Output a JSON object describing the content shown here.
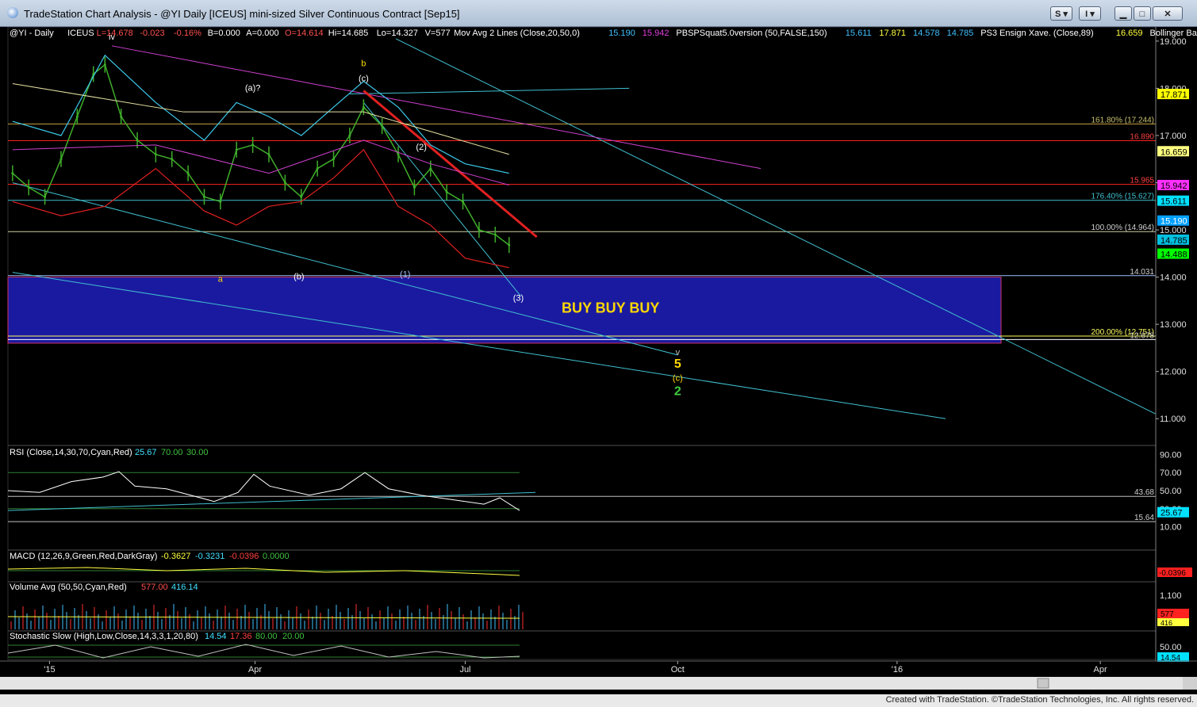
{
  "window": {
    "title": "TradeStation Chart Analysis - @YI Daily [ICEUS] mini-sized Silver Continuous Contract [Sep15]",
    "s_button": "S",
    "i_button": "I",
    "credit": "Created with TradeStation. ©TradeStation Technologies, Inc. All rights reserved."
  },
  "colors": {
    "background": "#000000",
    "price_bars": "#3fae2a",
    "bb_upper": "#3cc8ea",
    "bb_lower": "#e02020",
    "ma_magenta": "#d040d0",
    "ma_yellow": "#e6e0a0",
    "channel": "#40c0d0",
    "trend_red": "#e02020",
    "buy_zone": "#1a1aa0",
    "buy_text": "#ffd700"
  },
  "header": {
    "items": [
      {
        "text": "@YI - Daily",
        "color": "#ffffff"
      },
      {
        "text": "ICEUS",
        "color": "#ffffff"
      },
      {
        "text": "L=14.678",
        "color": "#ff5050"
      },
      {
        "text": "-0.023",
        "color": "#ff5050"
      },
      {
        "text": "-0.16%",
        "color": "#ff5050"
      },
      {
        "text": "B=0.000",
        "color": "#ffffff"
      },
      {
        "text": "A=0.000",
        "color": "#ffffff"
      },
      {
        "text": "O=14.614",
        "color": "#ff5050"
      },
      {
        "text": "Hi=14.685",
        "color": "#ffffff"
      },
      {
        "text": "Lo=14.327",
        "color": "#ffffff"
      },
      {
        "text": "V=577",
        "color": "#ffffff"
      },
      {
        "text": "Mov Avg 2 Lines (Close,20,50,0)",
        "color": "#ffffff"
      },
      {
        "text": "15.190",
        "color": "#40c0ff"
      },
      {
        "text": "15.942",
        "color": "#e040e0"
      },
      {
        "text": "PBSPSquat5.0version (50,FALSE,150)",
        "color": "#ffffff"
      },
      {
        "text": "15.611",
        "color": "#40c0ff"
      },
      {
        "text": "17.871",
        "color": "#ffff40"
      },
      {
        "text": "14.578",
        "color": "#40c0ff"
      },
      {
        "text": "14.785",
        "color": "#40c0ff"
      },
      {
        "text": "PS3 Ensign Xave. (Close,89)",
        "color": "#ffffff"
      },
      {
        "text": "16.659",
        "color": "#ffff40"
      },
      {
        "text": "Bollinger Bands (Close,Clos",
        "color": "#ffffff"
      }
    ]
  },
  "price_axis": {
    "ticks": [
      "19.000",
      "18.000",
      "17.000",
      "16.000",
      "15.000",
      "14.000",
      "13.000",
      "12.000",
      "11.000"
    ]
  },
  "price_badges": [
    {
      "value": 17.871,
      "text": "17.871",
      "bg": "#ffff00",
      "fg": "#000000"
    },
    {
      "value": 16.659,
      "text": "16.659",
      "bg": "#ffff80",
      "fg": "#000000"
    },
    {
      "value": 15.942,
      "text": "15.942",
      "bg": "#ff30ff",
      "fg": "#000000"
    },
    {
      "value": 15.611,
      "text": "15.611",
      "bg": "#00e0ff",
      "fg": "#000000"
    },
    {
      "value": 15.19,
      "text": "15.190",
      "bg": "#00a0ff",
      "fg": "#ffffff"
    },
    {
      "value": 14.785,
      "text": "14.785",
      "bg": "#00c0e0",
      "fg": "#000000"
    },
    {
      "value": 14.488,
      "text": "14.488",
      "bg": "#00ff00",
      "fg": "#000000"
    }
  ],
  "horizontal_lines": [
    {
      "value": 17.244,
      "label": "161.80% (17.244)",
      "color": "#c8a040",
      "label_color": "#c8c070"
    },
    {
      "value": 16.89,
      "label": "16.890",
      "color": "#ff2020",
      "label_color": "#ff4040"
    },
    {
      "value": 15.965,
      "label": "15.965",
      "color": "#ff2020",
      "label_color": "#ff4040"
    },
    {
      "value": 15.627,
      "label": "176.40% (15.627)",
      "color": "#40c0d0",
      "label_color": "#40c0d0"
    },
    {
      "value": 14.964,
      "label": "100.00% (14.964)",
      "color": "#d0d0a0",
      "label_color": "#d0d0d0"
    },
    {
      "value": 14.031,
      "label": "14.031",
      "color": "#a0c0ff",
      "label_color": "#d0d0d0"
    },
    {
      "value": 12.751,
      "label": "200.00% (12.751)",
      "color": "#ffff60",
      "label_color": "#ffff60"
    },
    {
      "value": 12.678,
      "label": "12.678",
      "color": "#ffffff",
      "label_color": "#d0d0d0"
    }
  ],
  "buy_zone": {
    "text": "BUY BUY BUY",
    "top": 14.0,
    "bottom": 12.6
  },
  "wave_labels": [
    {
      "text": "iv",
      "date": "2015-01-29",
      "value": 19.03,
      "color": "#ffffff"
    },
    {
      "text": "a",
      "date": "2015-03-17",
      "value": 13.9,
      "color": "#ffd700"
    },
    {
      "text": "(a)?",
      "date": "2015-03-31",
      "value": 17.95,
      "color": "#ffffff"
    },
    {
      "text": "(b)",
      "date": "2015-04-20",
      "value": 13.95,
      "color": "#ffffff"
    },
    {
      "text": "b",
      "date": "2015-05-18",
      "value": 18.47,
      "color": "#ffd700"
    },
    {
      "text": "(c)",
      "date": "2015-05-18",
      "value": 18.15,
      "color": "#ffffff"
    },
    {
      "text": "(1)",
      "date": "2015-06-05",
      "value": 14.0,
      "color": "#a0c0ff"
    },
    {
      "text": "(2)",
      "date": "2015-06-12",
      "value": 16.7,
      "color": "#ffffff"
    },
    {
      "text": "(3)",
      "date": "2015-07-24",
      "value": 13.5,
      "color": "#ffffff"
    },
    {
      "text": "v",
      "date": "2015-10-01",
      "value": 12.35,
      "color": "#c0c0c0"
    },
    {
      "text": "5",
      "date": "2015-10-01",
      "value": 12.08,
      "color": "#ffd700"
    },
    {
      "text": "(c)",
      "date": "2015-10-01",
      "value": 11.8,
      "color": "#ffd700"
    },
    {
      "text": "2",
      "date": "2015-10-01",
      "value": 11.5,
      "color": "#40d040"
    }
  ],
  "rsi": {
    "label": "RSI (Close,14,30,70,Cyan,Red)",
    "value": "25.67",
    "ob": "70.00",
    "os": "30.00",
    "ticks": [
      "90.00",
      "70.00",
      "50.00",
      "30.00",
      "10.00"
    ],
    "lines": [
      {
        "value": 43.68,
        "label": "43.68"
      },
      {
        "value": 15.64,
        "label": "15.64"
      }
    ],
    "badge": "25.67"
  },
  "macd": {
    "label": "MACD (12,26,9,Green,Red,DarkGray)",
    "macd": "-0.3627",
    "signal": "-0.3231",
    "diff": "-0.0396",
    "zero": "0.0000",
    "badge": "-0.0396"
  },
  "volume": {
    "label": "Volume Avg (50,50,Cyan,Red)",
    "v1": "577.00",
    "v2": "416.14",
    "tick": "1,100",
    "badge1": "577",
    "badge2": "416"
  },
  "stochastic": {
    "label": "Stochastic Slow (High,Low,Close,14,3,3,1,20,80)",
    "k": "14.54",
    "d": "17.36",
    "ob": "80.00",
    "os": "20.00",
    "tick": "50.00",
    "badge": "14.54"
  },
  "time_axis": {
    "labels": [
      {
        "text": "'15",
        "date": "2015-01-02"
      },
      {
        "text": "Apr",
        "date": "2015-04-01"
      },
      {
        "text": "Jul",
        "date": "2015-07-01"
      },
      {
        "text": "Oct",
        "date": "2015-10-01"
      },
      {
        "text": "'16",
        "date": "2016-01-04"
      },
      {
        "text": "Apr",
        "date": "2016-04-01"
      }
    ]
  },
  "chart_data": {
    "type": "line",
    "title": "@YI Daily [ICEUS] mini-sized Silver Continuous Contract [Sep15]",
    "xlabel": "",
    "ylabel": "",
    "x_range": [
      "2014-12-15",
      "2016-04-25"
    ],
    "ylim": [
      10.45,
      19.3
    ],
    "grid": false,
    "series": [
      {
        "name": "@YI - Daily",
        "x": [
          "2014-12-17",
          "2014-12-24",
          "2014-12-31",
          "2015-01-07",
          "2015-01-14",
          "2015-01-21",
          "2015-01-26",
          "2015-02-02",
          "2015-02-09",
          "2015-02-17",
          "2015-02-24",
          "2015-03-03",
          "2015-03-10",
          "2015-03-17",
          "2015-03-24",
          "2015-03-31",
          "2015-04-07",
          "2015-04-14",
          "2015-04-21",
          "2015-04-28",
          "2015-05-05",
          "2015-05-12",
          "2015-05-18",
          "2015-05-26",
          "2015-06-02",
          "2015-06-09",
          "2015-06-16",
          "2015-06-23",
          "2015-06-30",
          "2015-07-07",
          "2015-07-14",
          "2015-07-20"
        ],
        "values": [
          16.2,
          15.9,
          15.7,
          16.5,
          17.4,
          18.3,
          18.5,
          17.4,
          16.9,
          16.6,
          16.5,
          16.2,
          15.7,
          15.6,
          16.7,
          16.8,
          16.6,
          16.0,
          15.7,
          16.3,
          16.5,
          17.0,
          17.6,
          17.2,
          16.6,
          15.9,
          16.3,
          15.8,
          15.6,
          15.0,
          14.9,
          14.68
        ]
      },
      {
        "name": "Bollinger Band Upper",
        "x": [
          "2014-12-17",
          "2015-01-07",
          "2015-01-26",
          "2015-02-17",
          "2015-03-10",
          "2015-03-24",
          "2015-04-07",
          "2015-04-21",
          "2015-05-05",
          "2015-05-18",
          "2015-06-02",
          "2015-06-16",
          "2015-07-01",
          "2015-07-20"
        ],
        "values": [
          17.3,
          17.0,
          18.7,
          17.7,
          16.9,
          17.7,
          17.4,
          17.0,
          17.6,
          18.15,
          17.6,
          16.8,
          16.4,
          16.2
        ]
      },
      {
        "name": "Bollinger Band Lower",
        "x": [
          "2014-12-17",
          "2015-01-07",
          "2015-01-26",
          "2015-02-17",
          "2015-03-10",
          "2015-03-24",
          "2015-04-07",
          "2015-04-21",
          "2015-05-05",
          "2015-05-18",
          "2015-06-02",
          "2015-06-16",
          "2015-07-01",
          "2015-07-20"
        ],
        "values": [
          15.6,
          15.3,
          15.5,
          16.3,
          15.4,
          15.1,
          15.5,
          15.6,
          16.1,
          16.7,
          15.5,
          15.1,
          14.4,
          14.2
        ]
      }
    ],
    "annotations": [
      "BUY BUY BUY",
      "iv",
      "a",
      "(a)?",
      "(b)",
      "b",
      "(c)",
      "(1)",
      "(2)",
      "(3)",
      "v",
      "5",
      "(c)",
      "2"
    ]
  }
}
